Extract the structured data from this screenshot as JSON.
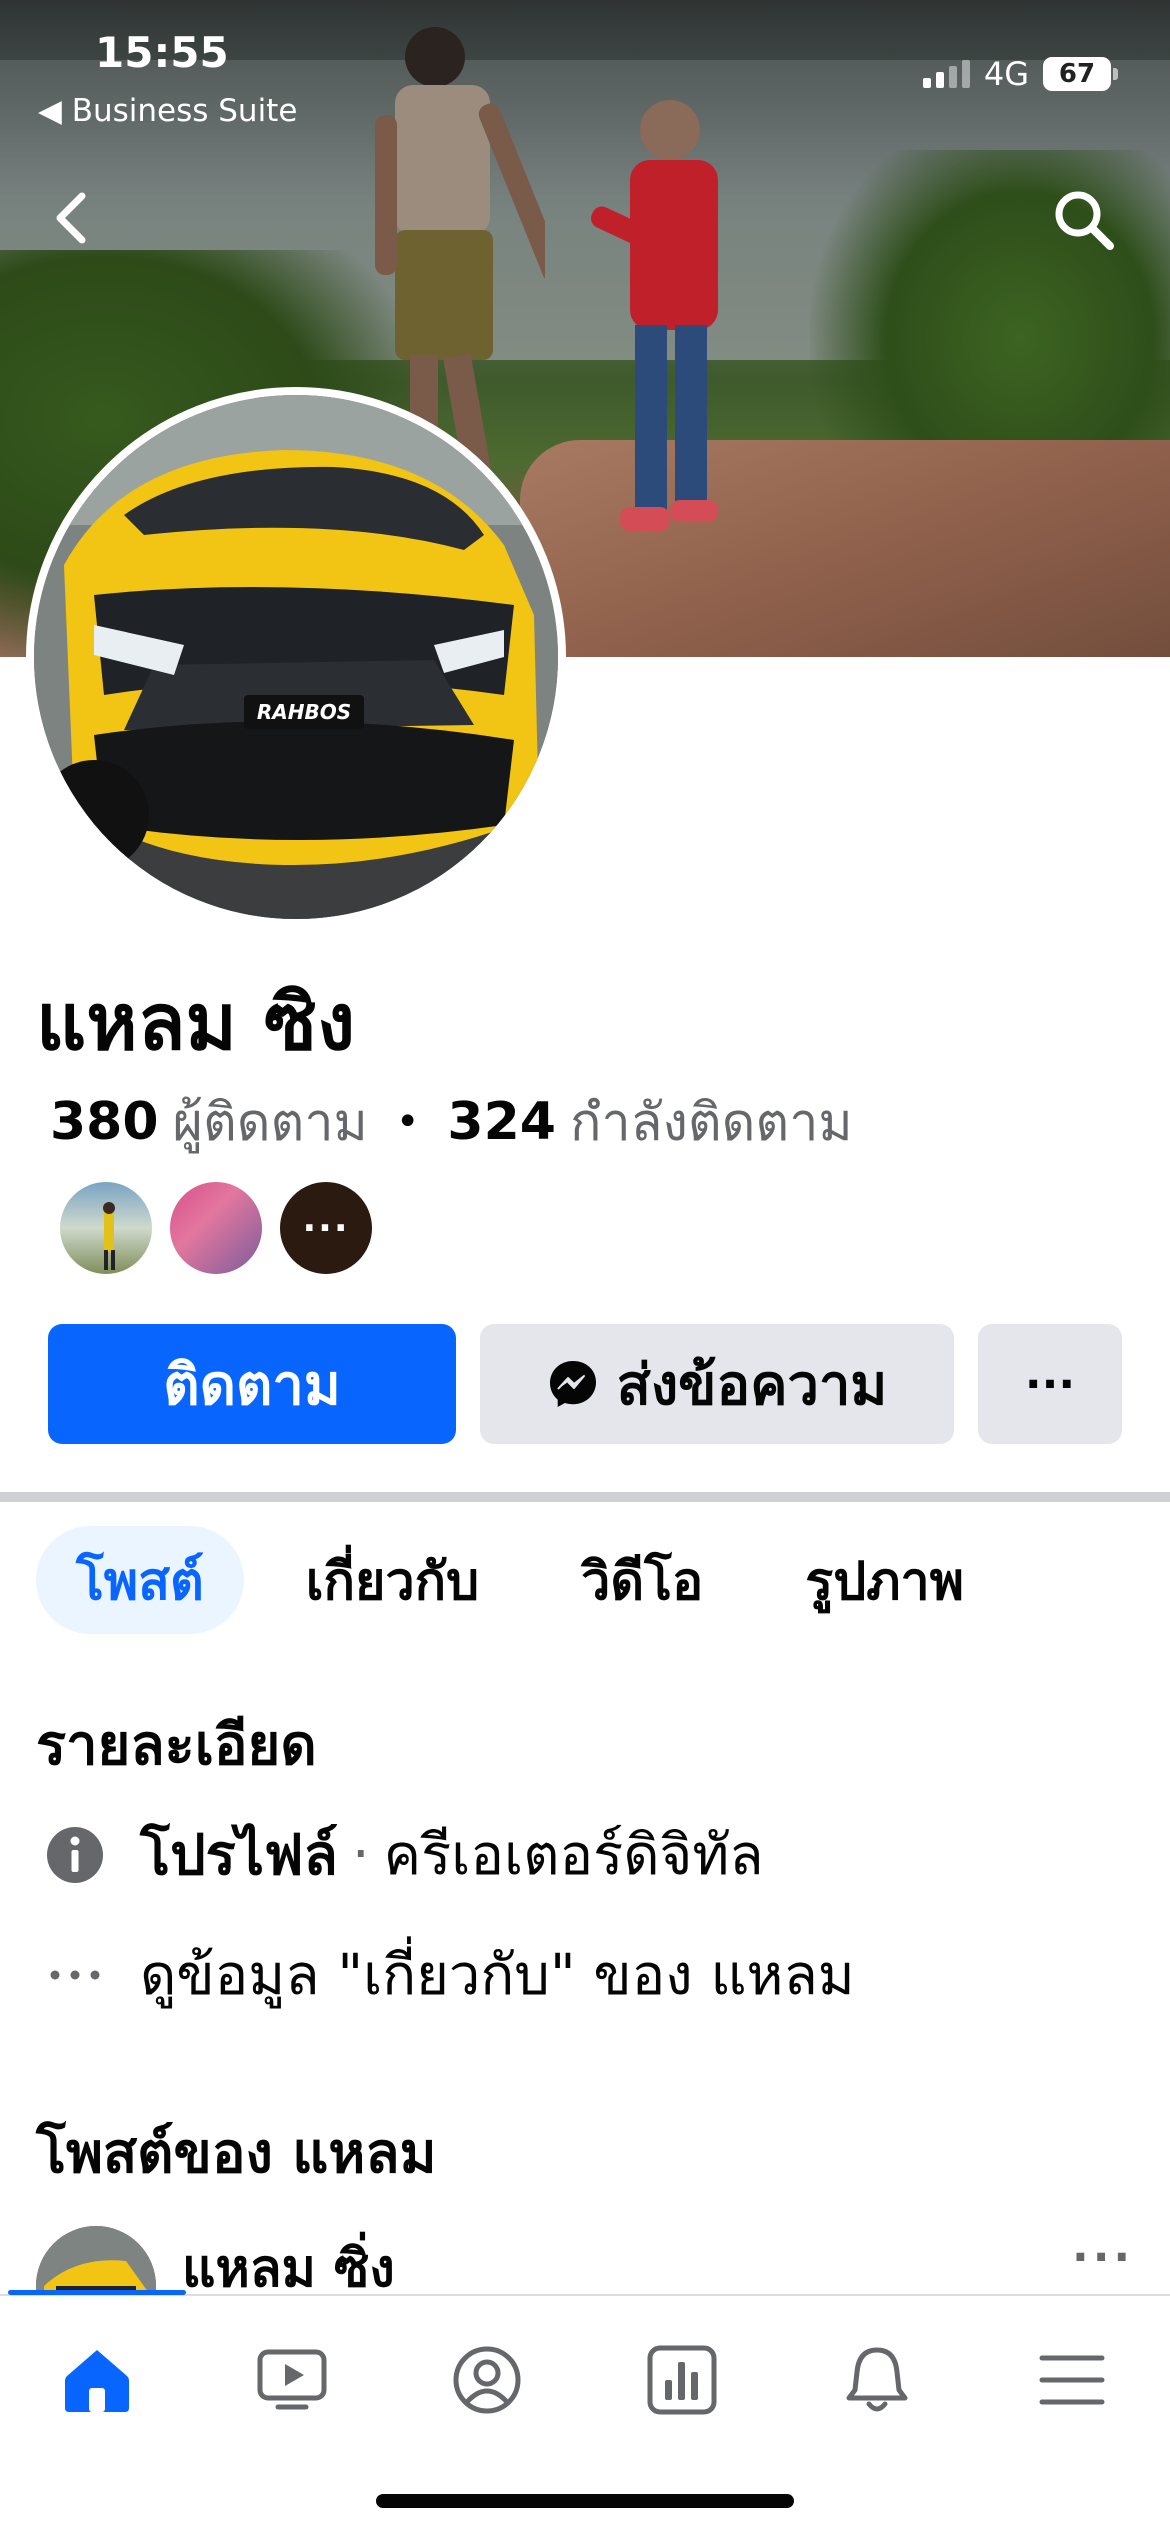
{
  "status_bar": {
    "time": "15:55",
    "back_app": "◀ Business Suite",
    "network": "4G",
    "battery": "67"
  },
  "profile": {
    "name": "แหลม ซิง",
    "followers_count": "380",
    "followers_label": "ผู้ติดตาม",
    "following_count": "324",
    "following_label": "กำลังติดตาม",
    "more_friends": "···"
  },
  "actions": {
    "follow": "ติดตาม",
    "message": "ส่งข้อความ",
    "more": "···"
  },
  "tabs": [
    {
      "label": "โพสต์",
      "active": true
    },
    {
      "label": "เกี่ยวกับ",
      "active": false
    },
    {
      "label": "วิดีโอ",
      "active": false
    },
    {
      "label": "รูปภาพ",
      "active": false
    }
  ],
  "details": {
    "title": "รายละเอียด",
    "profile_type_label": "โปรไฟล์",
    "profile_type_value": "ครีเอเตอร์ดิจิทัล",
    "about_link": "ดูข้อมูล \"เกี่ยวกับ\" ของ แหลม"
  },
  "posts": {
    "title": "โพสต์ของ แหลม",
    "author": "แหลม ซิ่ง",
    "more": "···"
  },
  "avatar_plate": "RAHBOS",
  "colors": {
    "accent": "#0866ff",
    "secondary_button": "#e4e6eb",
    "muted_text": "#65676b",
    "active_tab_bg": "#ebf5ff"
  },
  "icons": {
    "nav": [
      "home-icon",
      "video-icon",
      "profile-icon",
      "dashboard-icon",
      "bell-icon",
      "menu-icon"
    ]
  }
}
